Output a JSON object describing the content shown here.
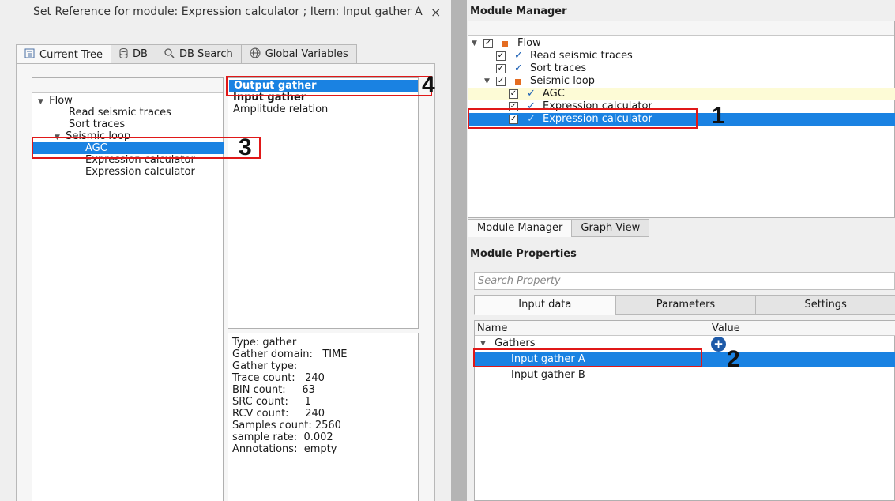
{
  "dialog": {
    "title": "Set Reference for module: Expression calculator ; Item: Input gather A",
    "close_glyph": "×",
    "tabs": [
      {
        "label": "Current Tree",
        "icon": "tree-icon"
      },
      {
        "label": "DB",
        "icon": "database-icon"
      },
      {
        "label": "DB Search",
        "icon": "search-icon"
      },
      {
        "label": "Global Variables",
        "icon": "globe-icon"
      }
    ],
    "tree": [
      {
        "label": "Flow"
      },
      {
        "label": "Read seismic traces"
      },
      {
        "label": "Sort traces"
      },
      {
        "label": "Seismic loop"
      },
      {
        "label": "AGC"
      },
      {
        "label": "Expression calculator"
      },
      {
        "label": "Expression calculator"
      }
    ],
    "outputs": [
      "Output gather",
      "Input gather",
      "Amplitude relation"
    ],
    "info": [
      "Type: gather",
      "Gather domain:   TIME",
      "Gather type:",
      "Trace count:   240",
      "BIN count:     63",
      "SRC count:     1",
      "RCV count:     240",
      "Samples count: 2560",
      "sample rate:  0.002",
      "Annotations:  empty"
    ]
  },
  "module_manager": {
    "title": "Module Manager",
    "tree": [
      {
        "label": "Flow"
      },
      {
        "label": "Read seismic traces"
      },
      {
        "label": "Sort traces"
      },
      {
        "label": "Seismic loop"
      },
      {
        "label": "AGC"
      },
      {
        "label": "Expression calculator"
      },
      {
        "label": "Expression calculator"
      }
    ],
    "tabs": [
      "Module Manager",
      "Graph View"
    ]
  },
  "module_properties": {
    "title": "Module Properties",
    "search_placeholder": "Search Property",
    "tabs": [
      "Input data",
      "Parameters",
      "Settings"
    ],
    "columns": [
      "Name",
      "Value"
    ],
    "rows": [
      {
        "label": "Gathers"
      },
      {
        "label": "Input gather A"
      },
      {
        "label": "Input gather B"
      }
    ]
  },
  "annotations": [
    "1",
    "2",
    "3",
    "4"
  ],
  "colors": {
    "selection": "#1a82e2",
    "annotation_box": "#e01818",
    "flow_square": "#e46c21",
    "check": "#1a5fb4"
  }
}
